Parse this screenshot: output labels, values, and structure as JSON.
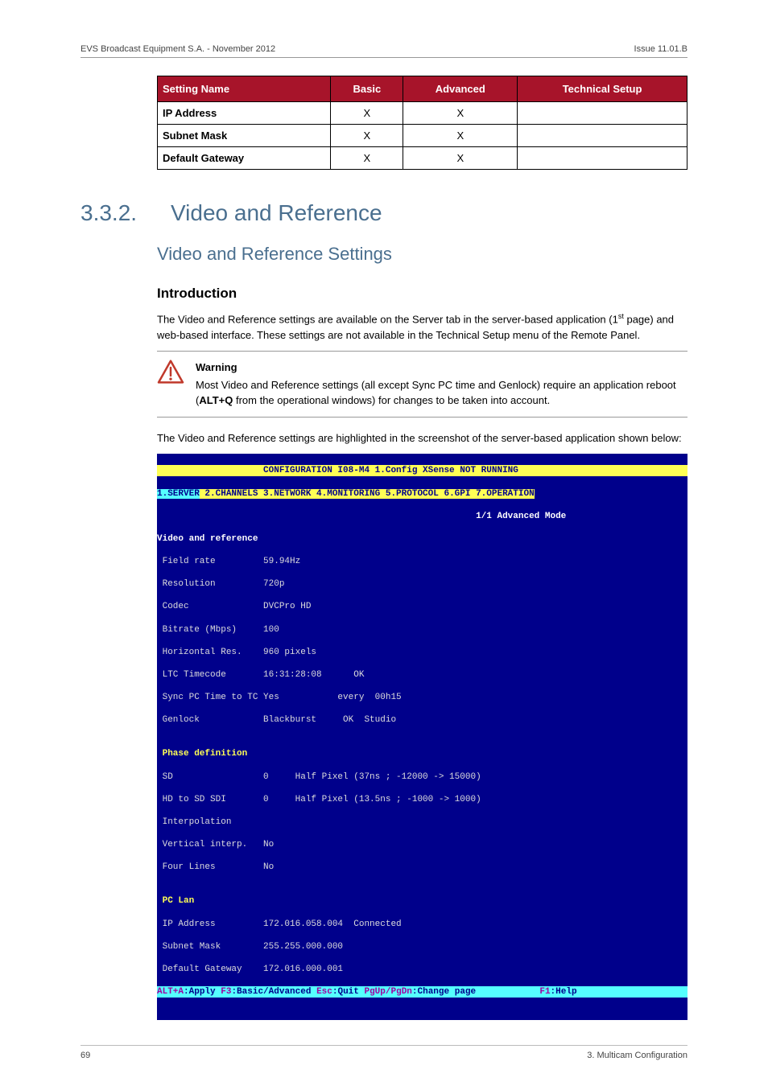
{
  "header": {
    "left": "EVS Broadcast Equipment S.A.  - November 2012",
    "right": "Issue 11.01.B"
  },
  "table": {
    "cols": [
      "Setting Name",
      "Basic",
      "Advanced",
      "Technical Setup"
    ],
    "rows": [
      {
        "name": "IP Address",
        "basic": "X",
        "advanced": "X",
        "tech": ""
      },
      {
        "name": "Subnet Mask",
        "basic": "X",
        "advanced": "X",
        "tech": ""
      },
      {
        "name": "Default Gateway",
        "basic": "X",
        "advanced": "X",
        "tech": ""
      }
    ]
  },
  "section": {
    "num": "3.3.2.",
    "title": "Video and Reference"
  },
  "subsection": {
    "title": "Video and Reference Settings"
  },
  "intro": {
    "heading": "Introduction",
    "para": "The Video and Reference settings are available on the Server tab in the server-based application (1",
    "para_after_sup": " page) and web-based interface. These settings are not available in the Technical Setup menu of the Remote Panel.",
    "sup": "st"
  },
  "warning": {
    "title": "Warning",
    "text1": "Most Video and Reference settings (all except Sync PC time and Genlock) require an application reboot (",
    "bold": "ALT+Q",
    "text2": " from the operational windows) for changes to be taken into account."
  },
  "para2": "The Video and Reference settings are highlighted in the screenshot of the server-based application shown below:",
  "terminal": {
    "title": "                    CONFIGURATION I08-M4 1.Config XSense NOT RUNNING           ",
    "tabs_pre": "1.SERVER",
    "tabs_rest": " 2.CHANNELS 3.NETWORK 4.MONITORING 5.PROTOCOL 6.GPI 7.OPERATION",
    "mode": "                                                            1/1 Advanced Mode",
    "lines": [
      {
        "label": "Video and reference",
        "cls": "t-white"
      },
      {
        "text": " Field rate         59.94Hz"
      },
      {
        "text": " Resolution         720p"
      },
      {
        "text": " Codec              DVCPro HD"
      },
      {
        "text": " Bitrate (Mbps)     100"
      },
      {
        "text": " Horizontal Res.    960 pixels"
      },
      {
        "text": " LTC Timecode       16:31:28:08      OK"
      },
      {
        "text": " Sync PC Time to TC Yes           every  00h15"
      },
      {
        "text": " Genlock            Blackburst     OK  Studio"
      },
      {
        "text": ""
      },
      {
        "label": " Phase definition",
        "cls": "t-yellow"
      },
      {
        "text": " SD                 0     Half Pixel (37ns ; -12000 -> 15000)"
      },
      {
        "text": " HD to SD SDI       0     Half Pixel (13.5ns ; -1000 -> 1000)"
      },
      {
        "text": " Interpolation"
      },
      {
        "text": " Vertical interp.   No"
      },
      {
        "text": " Four Lines         No"
      },
      {
        "text": ""
      },
      {
        "label": " PC Lan",
        "cls": "t-yellow"
      },
      {
        "text": " IP Address         172.016.058.004  Connected"
      },
      {
        "text": " Subnet Mask        255.255.000.000"
      },
      {
        "text": " Default Gateway    172.016.000.001"
      }
    ],
    "footer_parts": {
      "a1": "ALT+A",
      "a2": ":Apply ",
      "b1": "F3",
      "b2": ":Basic/Advanced ",
      "c1": "Esc",
      "c2": ":Quit ",
      "d1": "PgUp/PgDn",
      "d2": ":Change page",
      "gap": "            ",
      "e1": "F1",
      "e2": ":Help "
    }
  },
  "footer": {
    "left": "69",
    "right": "3. Multicam Configuration"
  }
}
